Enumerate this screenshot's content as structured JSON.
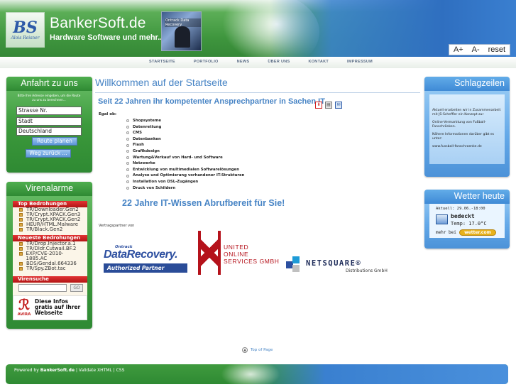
{
  "header": {
    "site_title": "BankerSoft.de",
    "site_subtitle": "Hardware Software und mehr...",
    "logo_text": "BS",
    "logo_sub": "Alois Reisner",
    "header_image_label": "Ontrack Data Recovery",
    "font_controls": {
      "increase": "A+",
      "decrease": "A-",
      "reset": "reset"
    }
  },
  "nav": {
    "items": [
      "STARTSEITE",
      "PORTFOLIO",
      "NEWS",
      "ÜBER UNS",
      "KONTAKT",
      "IMPRESSUM"
    ]
  },
  "route": {
    "title": "Anfahrt zu uns",
    "intro": "Bitte Ihre Adresse eingeben, um die Route zu uns zu berechnen...",
    "street": "Strasse Nr.",
    "city": "Stadt",
    "country": "Deutschland",
    "plan_button": "Route planen",
    "back_button": "Weg zurück ..."
  },
  "virus": {
    "title": "Virenalarme",
    "top_threats_label": "Top Bedrohungen",
    "top_threats": [
      "TR/Downloader.Gen2",
      "TR/Crypt.XPACK.Gen3",
      "TR/Crypt.XPACK.Gen2",
      "HEUR/HTML.Malware",
      "TR/Black.Gen2"
    ],
    "new_threats_label": "Neueste Bedrohungen",
    "new_threats": [
      "TR/Drop.Injector.a.1",
      "TR/Dldr.Cutwail.BF.2",
      "EXP/CVE-2010-1885.AC",
      "BDS/Gendal.664336",
      "TR/Spy.ZBot.tac"
    ],
    "search_label": "Virensuche",
    "search_go": "GO",
    "avira_logo": "AVIRA",
    "avira_text": "Diese Infos gratis auf Ihrer Webseite"
  },
  "main": {
    "title": "Willkommen auf der Startseite",
    "heading": "Seit 22 Jahren ihr kompetenter Ansprechpartner in Sachen IT",
    "egal": "Egal ob:",
    "services": [
      "Shopsysteme",
      "Datenrettung",
      "CMS",
      "Datenbanken",
      "Flash",
      "Grafikdesign",
      "Wartung&Verkauf von Hard- und Software",
      "Netzwerke",
      "Entwicklung von multimedialen Softwarelösungen",
      "Analyse und Optimierung vorhandener IT-Strukturen",
      "Installation von DSL-Zugängen",
      "Druck von Schildern"
    ],
    "slogan": "22 Jahre IT-Wissen Abrufbereit für Sie!",
    "partners_label": "Vertragspartner von",
    "partner_dr": {
      "small": "Ontrack",
      "main": "DataRecovery.",
      "bar": "Authorized Partner"
    },
    "partner_uo": {
      "line1": "UNITED",
      "line2": "ONLINE",
      "line3": "SERVICES GMBH"
    },
    "partner_ns": {
      "main": "NETSQUARE®",
      "sub": "Distributions GmbH"
    },
    "top_of_page": "Top of Page"
  },
  "news": {
    "title": "Schlagzeilen",
    "items": [
      "Aktuell erarbeiten wir in Zusammenarbeit mit JS-Scheffler ein Konzept zur",
      "Online-Vermarktung von Fußball-Fanschränken.",
      "Nähere Informationen darüber gibt es unter:",
      "www.fussball-fanschraenke.de"
    ]
  },
  "weather": {
    "title": "Wetter heute",
    "date": "Aktuell: 29.06.-18:00",
    "status": "bedeckt",
    "temp": "Temp: 17.0°C",
    "more": "mehr bei",
    "badge": "wetter.com"
  },
  "footer": {
    "prefix": "Powered by",
    "brand": "BankerSoft.de",
    "rest": "| Validate XHTML | CSS"
  },
  "colors": {
    "green": "#3c9a3c",
    "blue_link": "#4784c5",
    "alarm_red": "#c31d1d"
  }
}
